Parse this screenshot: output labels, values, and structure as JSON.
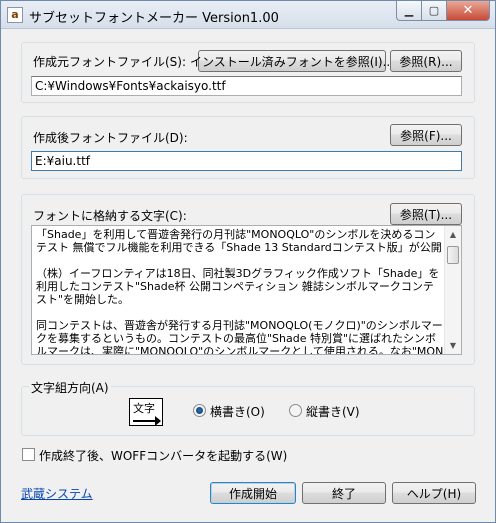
{
  "window": {
    "title": "サブセットフォントメーカー  Version1.00",
    "minimize_glyph": "▁",
    "maximize_glyph": "▢",
    "close_glyph": "✕",
    "icon_glyph": "a"
  },
  "source_group": {
    "label": "作成元フォントファイル(S):",
    "installed_button": "インストール済みフォントを参照(I)...",
    "browse_button": "参照(R)...",
    "path_value": "C:¥Windows¥Fonts¥ackaisyo.ttf"
  },
  "output_group": {
    "label": "作成後フォントファイル(D):",
    "browse_button": "参照(F)...",
    "path_value": "E:¥aiu.ttf"
  },
  "chars_group": {
    "label": "フォントに格納する文字(C):",
    "browse_button": "参照(T)...",
    "text": "「Shade」を利用して晋遊舎発行の月刊誌\"MONOQLO\"のシンボルを決めるコンテスト 無償でフル機能を利用できる「Shade 13 Standardコンテスト版」が公開\n\n（株）イーフロンティアは18日、同社製3Dグラフィック作成ソフト「Shade」を利用したコンテスト\"Shade杯 公開コンペティション 雑誌シンボルマークコンテスト\"を開始した。\n\n同コンテストは、晋遊舎が発行する月刊誌\"MONOQLO(モノクロ)\"のシンボルマークを募集するというもの。コンテストの最高位\"Shade 特別賞\"に選ばれたシンボルマークは、実際に\"MONOQLO\"のシンボルマークとして使用される。なお\"MONOQLO\"は、\"消費\"をテーマにあらゆるジャンルを扱う雑誌となっている。"
  },
  "direction_group": {
    "label": "文字組方向(A)",
    "icon_text": "文字",
    "horizontal_label": "横書き(O)",
    "vertical_label": "縦書き(V)",
    "selected": "horizontal"
  },
  "woff_checkbox": {
    "label": "作成終了後、WOFFコンバータを起動する(W)",
    "checked": false
  },
  "footer": {
    "link": "武蔵システム",
    "create_button": "作成開始",
    "exit_button": "終了",
    "help_button": "ヘルプ(H)"
  },
  "colors": {
    "link": "#0645ad",
    "close_button": "#c74a36",
    "default_button_border": "#3c7fb1"
  }
}
